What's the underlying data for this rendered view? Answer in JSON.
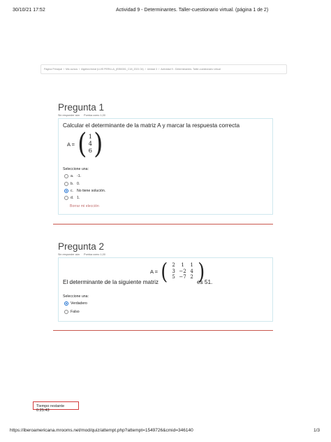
{
  "print_header": {
    "datetime": "30/10/21 17:52",
    "title": "Actividad 9 - Determinantes. Taller-cuestionario virtual. (página 1 de 2)"
  },
  "breadcrumb": [
    "Página Principal",
    "Mis cursos",
    "Algebra lineal (LUIS PERILLA_(EIB0301_C18_2021 04)",
    "Unidad 3",
    "Actividad 9 - Determinantes. Taller-cuestionario virtual"
  ],
  "question1": {
    "title": "Pregunta 1",
    "status": "Sin responder aún",
    "score": "Puntúa como 1,00",
    "text": "Calcular el determinante de la matriz A y marcar la respuesta correcta",
    "matrix_label": "A =",
    "matrix": [
      "1",
      "4",
      "6"
    ],
    "select_label": "Seleccione una:",
    "options": [
      {
        "letter": "a.",
        "text": "-1.",
        "checked": false
      },
      {
        "letter": "b.",
        "text": "0.",
        "checked": false
      },
      {
        "letter": "c.",
        "text": "No tiene solución.",
        "checked": true
      },
      {
        "letter": "d.",
        "text": "1.",
        "checked": false
      }
    ],
    "clear_label": "Borrar mi elección"
  },
  "question2": {
    "title": "Pregunta 2",
    "status": "Sin responder aún",
    "score": "Puntúa como 1,00",
    "text_before": "El determinante de la siguiente matriz",
    "matrix_label": "A =",
    "matrix": [
      [
        "2",
        "1",
        "1"
      ],
      [
        "3",
        "−2",
        "4"
      ],
      [
        "5",
        "−7",
        "2"
      ]
    ],
    "text_after": "es 51.",
    "select_label": "Seleccione una:",
    "options": [
      {
        "text": "Verdadero",
        "checked": true
      },
      {
        "text": "Falso",
        "checked": false
      }
    ]
  },
  "timer": {
    "text": "Tiempo restante 0:25:43"
  },
  "print_footer": {
    "url": "https://iberoamericana.mrooms.net/mod/quiz/attempt.php?attempt=1549726&cmid=346140",
    "page": "1/3"
  },
  "colors": {
    "box_border": "#cfe8ee",
    "divider": "#c9574e",
    "radio_checked": "#1b6fd1",
    "clear_link": "#c16d6d",
    "timer_border": "#d23b3b"
  }
}
